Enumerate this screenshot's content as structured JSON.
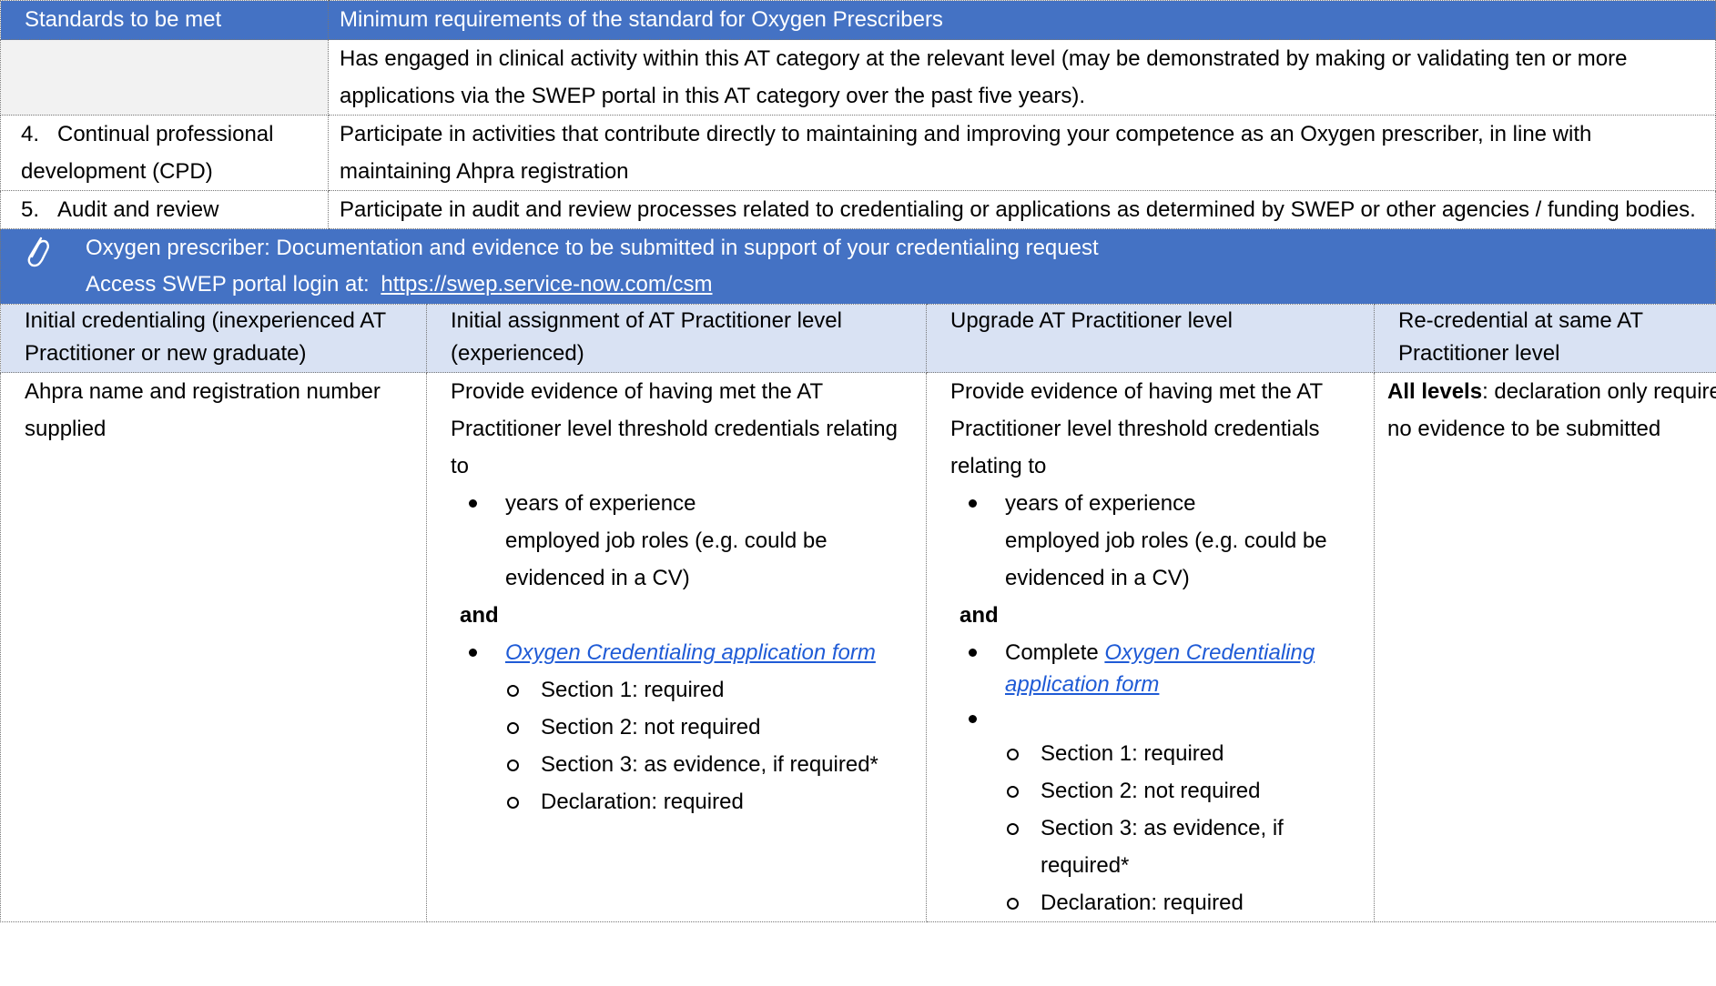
{
  "standards_table": {
    "header": {
      "col1": "Standards to be met",
      "col2": "Minimum requirements of the standard for Oxygen Prescribers"
    },
    "rows": [
      {
        "number": "",
        "standard": "",
        "requirement": "Has engaged in clinical activity within this AT category at the relevant level (may be demonstrated by making or validating ten or more applications via the SWEP portal in this AT category over the past five years)."
      },
      {
        "number": "4.",
        "standard": "Continual professional development (CPD)",
        "requirement": "Participate in activities that contribute directly to maintaining and improving your competence as an Oxygen prescriber, in line with maintaining Ahpra registration"
      },
      {
        "number": "5.",
        "standard": "Audit and review",
        "requirement": "Participate in audit and review processes related to credentialing or applications as determined by SWEP or other agencies / funding bodies."
      }
    ]
  },
  "banner": {
    "icon": "paperclip-icon",
    "line1": "Oxygen prescriber: Documentation and evidence to be submitted in support of your credentialing request",
    "line2_prefix": "Access SWEP portal login at:",
    "portal_url": "https://swep.service-now.com/csm"
  },
  "credential_table": {
    "headers": [
      "Initial credentialing (inexperienced AT Practitioner or new graduate)",
      "Initial assignment of AT Practitioner level (experienced)",
      "Upgrade AT Practitioner level",
      "Re-credential at same AT Practitioner level"
    ],
    "col1": {
      "text": "Ahpra name and registration number supplied"
    },
    "col2": {
      "intro": "Provide evidence of having met the AT Practitioner level threshold credentials relating to",
      "bullet1_line1": "years of experience",
      "bullet1_line2": "employed job roles (e.g. could be evidenced in a CV)",
      "and": "and",
      "form_link": "Oxygen Credentialing application form",
      "sub": [
        "Section 1: required",
        "Section 2: not required",
        "Section 3: as evidence, if required*",
        "Declaration: required"
      ]
    },
    "col3": {
      "intro": "Provide evidence of having met the AT Practitioner level threshold credentials relating to",
      "bullet1_line1": "years of experience",
      "bullet1_line2": "employed job roles (e.g. could be evidenced in a CV)",
      "and": "and",
      "complete_prefix": "Complete",
      "form_link": "Oxygen Credentialing application form",
      "sub": [
        "Section 1: required",
        "Section 2: not required",
        "Section 3: as evidence, if required*",
        "Declaration: required"
      ]
    },
    "col4": {
      "bold": "All levels",
      "rest": ": declaration only required, no evidence to be submitted"
    }
  }
}
